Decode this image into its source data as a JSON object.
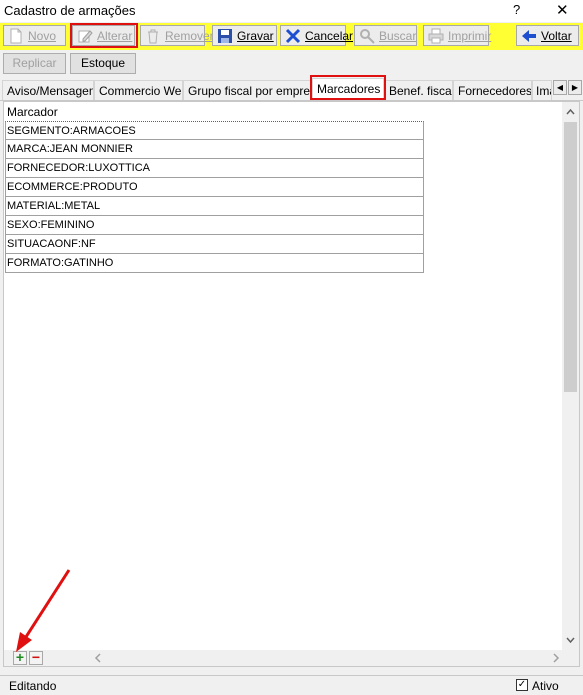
{
  "window": {
    "title": "Cadastro de armações",
    "help": "?",
    "close": "✕"
  },
  "toolbar": {
    "novo": "Novo",
    "alterar": "Alterar",
    "remover": "Remover",
    "gravar": "Gravar",
    "cancelar": "Cancelar",
    "buscar": "Buscar",
    "imprimir": "Imprimir",
    "voltar": "Voltar"
  },
  "actions": {
    "replicar": "Replicar",
    "estoque": "Estoque"
  },
  "tabs": [
    "Aviso/Mensagem",
    "Commercio Web",
    "Grupo fiscal por empresa",
    "Marcadores",
    "Benef. fiscal",
    "Fornecedores",
    "Ima"
  ],
  "grid": {
    "header": "Marcador",
    "rows": [
      "SEGMENTO:ARMACOES",
      "MARCA:JEAN MONNIER",
      "FORNECEDOR:LUXOTTICA",
      "ECOMMERCE:PRODUTO",
      "MATERIAL:METAL",
      "SEXO:FEMININO",
      "SITUACAONF:NF",
      "FORMATO:GATINHO"
    ]
  },
  "nav": {
    "add": "+",
    "remove": "−"
  },
  "status": {
    "mode": "Editando",
    "ativo_label": "Ativo",
    "ativo_checked": true
  },
  "colors": {
    "toolbar_bg": "#ffff33",
    "highlight": "#e01010"
  }
}
